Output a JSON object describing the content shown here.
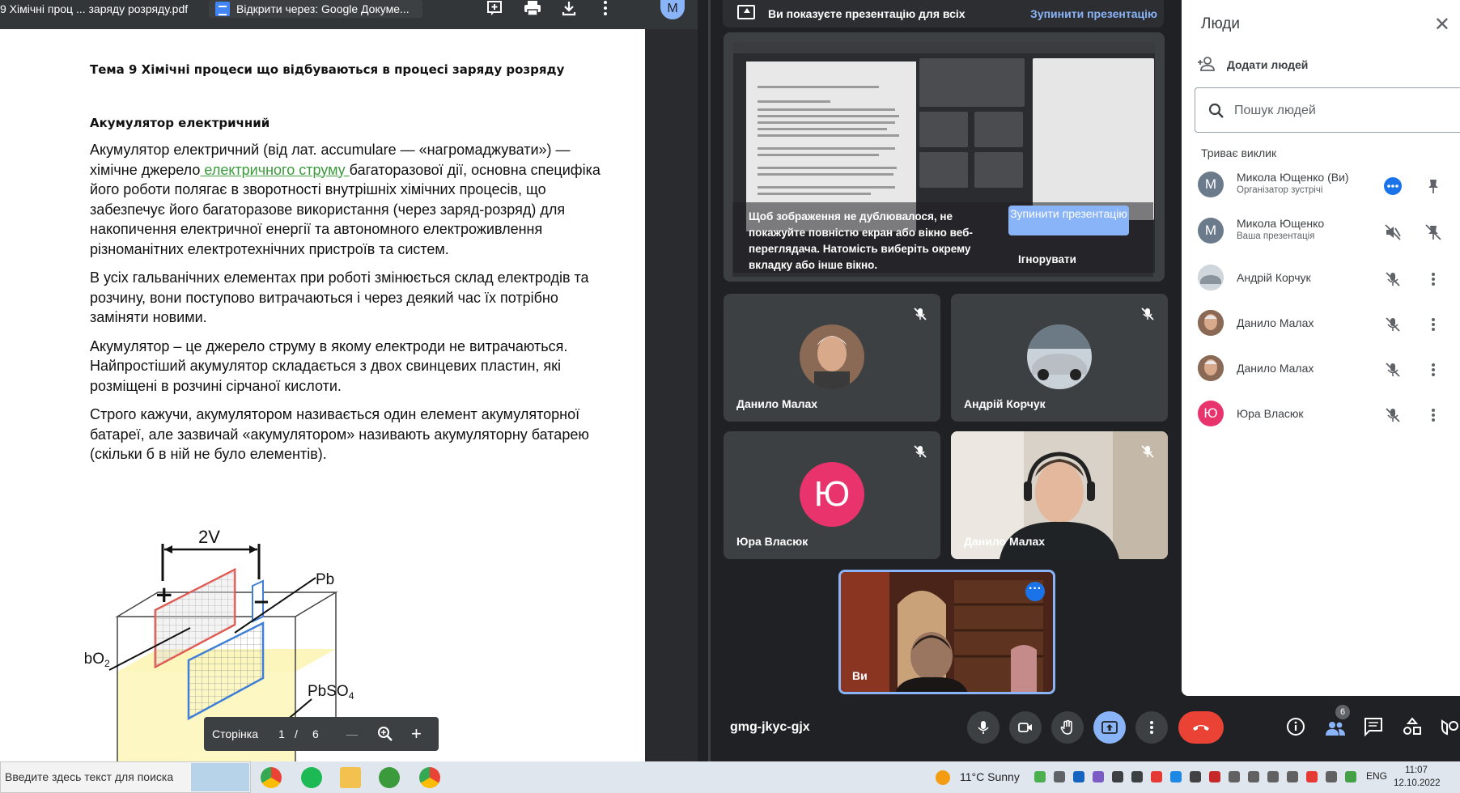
{
  "pdf_viewer": {
    "title": "9 Хімічні проц ... заряду розряду.pdf",
    "open_with": "Відкрити через: Google Докуме...",
    "avatar_letter": "M",
    "document": {
      "heading": "Тема 9 Хімічні процеси що відбуваються в процесі заряду розряду",
      "subheading": "Акумулятор електричний",
      "p1_before_link": "Акумулятор електричний (від  лат. accumulare — «нагромаджувати») — хімічне джерело",
      "p1_link": " електричного струму ",
      "p1_after_link": "багаторазової дії, основна специфіка його роботи полягає в зворотності внутрішніх хімічних процесів, що забезпечує його багаторазове використання (через заряд-розряд) для накопичення електричної енергії та автономного електроживлення різноманітних електротехнічних пристроїв та систем.",
      "p2": "В усіх гальванічних елементах при роботі змінюється склад електродів та розчину, вони поступово витрачаються і через деякий час їх потрібно заміняти новими.",
      "p3": "Акумулятор – це джерело струму в якому електроди не витрачаються. Найпростіший акумулятор складається з двох свинцевих пластин, які розміщені в розчині сірчаної кислоти.",
      "p4": "Строго кажучи, акумулятором називається один елемент акумуляторної батареї, але зазвичай «акумулятором» називають акумуляторну батарею (скільки б в ній не було елементів).",
      "diagram_labels": {
        "voltage": "2V",
        "pb": "Pb",
        "pbo2": "PbO",
        "pbo2_sub": "2",
        "pbso4": "PbSO",
        "pbso4_sub": "4"
      }
    },
    "page_control": {
      "label": "Сторінка",
      "current": "1",
      "separator": "/",
      "total": "6",
      "minus": "—",
      "plus": "+"
    }
  },
  "meet": {
    "present_bar": {
      "text": "Ви показуєте презентацію для всіх",
      "stop": "Зупинити презентацію"
    },
    "screen_share": {
      "warning": "Щоб зображення не дублювалося, не покажуйте повністю екран або вікно веб-переглядача. Натомість виберіть окрему вкладку або інше вікно.",
      "stop_button": "Зупинити презентацію",
      "ignore": "Ігнорувати"
    },
    "tiles": [
      {
        "name": "Данило Малах"
      },
      {
        "name": "Андрій Корчук"
      },
      {
        "name": "Юра Власюк",
        "letter": "Ю"
      },
      {
        "name": "Данило Малах"
      }
    ],
    "self_tile": {
      "name": "Ви"
    },
    "meeting_code": "gmg-jkyc-gjx",
    "people_badge": "6"
  },
  "people_panel": {
    "title": "Люди",
    "add_people": "Додати людей",
    "search_placeholder": "Пошук людей",
    "section": "Триває виклик",
    "people": [
      {
        "name": "Микола Ющенко (Ви)",
        "sub": "Організатор зустрічі",
        "letter": "M"
      },
      {
        "name": "Микола Ющенко",
        "sub": "Ваша презентація",
        "letter": "M"
      },
      {
        "name": "Андрій Корчук"
      },
      {
        "name": "Данило Малах"
      },
      {
        "name": "Данило Малах"
      },
      {
        "name": "Юра Власюк",
        "letter": "Ю"
      }
    ]
  },
  "taskbar": {
    "search_placeholder": "Введите здесь текст для поиска",
    "weather": "11°C  Sunny",
    "language": "ENG",
    "time": "11:07",
    "date": "12.10.2022"
  },
  "colors": {
    "accent": "#8ab4f8",
    "hangup": "#ea4335",
    "avatar_pink": "#e8336d",
    "link_green": "#3a9a3a"
  }
}
